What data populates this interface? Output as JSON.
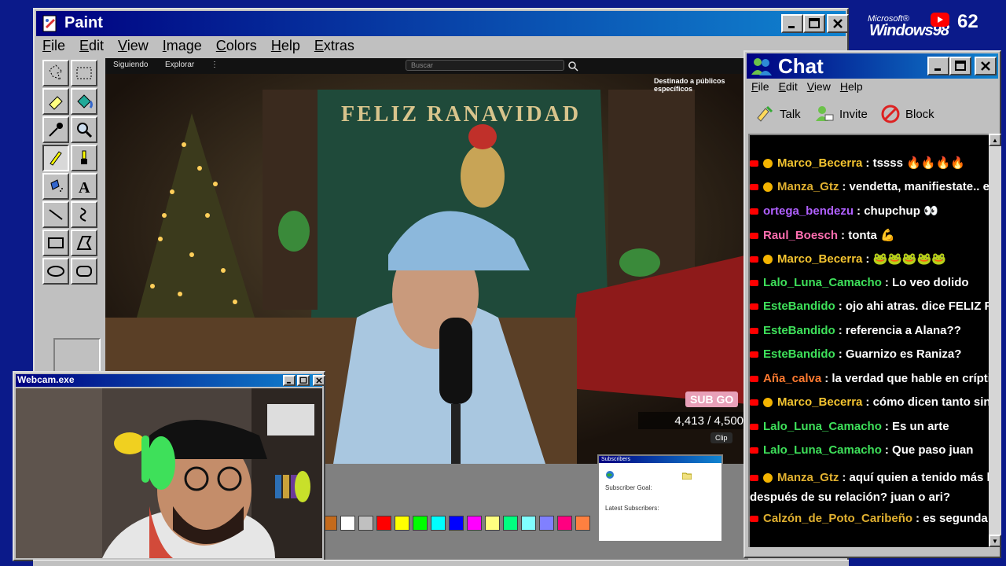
{
  "paint": {
    "title": "Paint",
    "menu": [
      "File",
      "Edit",
      "View",
      "Image",
      "Colors",
      "Help",
      "Extras"
    ]
  },
  "stream": {
    "nav_following": "Siguiendo",
    "nav_explore": "Explorar",
    "nav_more": "⋮",
    "search_placeholder": "Buscar",
    "audience_notice": "Destinado a públicos específicos",
    "sign_text": "FELIZ RANAVIDAD",
    "counter": "4,413  / 4,500",
    "sub_goal_label": "SUB GO",
    "clip_label": "Clip"
  },
  "subscribers_widget": {
    "title": "Subscribers",
    "goal_label": "Subscriber Goal:",
    "latest_label": "Latest Subscribers:"
  },
  "palette_colors": [
    "#c46a1c",
    "#ffffff",
    "#c0c0c0",
    "#ff0000",
    "#ffff00",
    "#00ff00",
    "#00ffff",
    "#0000ff",
    "#ff00ff",
    "#ffff80",
    "#00ff80",
    "#80ffff",
    "#8080ff",
    "#ff0080",
    "#ff8040"
  ],
  "branding": {
    "microsoft": "Microsoft®",
    "windows": "Windows98",
    "youtube_count": "62"
  },
  "chat": {
    "title": "Chat",
    "menu": [
      "File",
      "Edit",
      "View",
      "Help"
    ],
    "toolbar": {
      "talk": "Talk",
      "invite": "Invite",
      "block": "Block"
    },
    "messages": [
      {
        "user": "Marco_Becerra",
        "color": "#f4c430",
        "badge": true,
        "text": ": tssss 🔥🔥🔥🔥"
      },
      {
        "user": "Manza_Gtz",
        "color": "#e0b030",
        "badge": true,
        "text": ": vendetta, manifiestate.. est"
      },
      {
        "user": "ortega_bendezu",
        "color": "#b060ff",
        "badge": false,
        "text": ": chupchup 👀"
      },
      {
        "user": "Raul_Boesch",
        "color": "#ff6fb0",
        "badge": false,
        "text": ": tonta 💪"
      },
      {
        "user": "Marco_Becerra",
        "color": "#f4c430",
        "badge": true,
        "text": ": 🐸🐸🐸🐸🐸"
      },
      {
        "user": "Lalo_Luna_Camacho",
        "color": "#3ee05a",
        "badge": false,
        "text": ": Lo veo dolido"
      },
      {
        "user": "EsteBandido",
        "color": "#3ee05a",
        "badge": false,
        "text": ": ojo ahi atras. dice FELIZ RA"
      },
      {
        "user": "EsteBandido",
        "color": "#3ee05a",
        "badge": false,
        "text": ": referencia a Alana??"
      },
      {
        "user": "EsteBandido",
        "color": "#3ee05a",
        "badge": false,
        "text": ": Guarnizo es Raniza?"
      },
      {
        "user": "Aña_calva",
        "color": "#ff7a30",
        "badge": false,
        "text": ": la verdad que hable en críptico"
      },
      {
        "user": "Marco_Becerra",
        "color": "#f4c430",
        "badge": true,
        "text": ": cómo dicen tanto sin d"
      },
      {
        "user": "Lalo_Luna_Camacho",
        "color": "#3ee05a",
        "badge": false,
        "text": ": Es un arte"
      },
      {
        "user": "Lalo_Luna_Camacho",
        "color": "#3ee05a",
        "badge": false,
        "text": ": Que paso juan"
      },
      {
        "user": "Manza_Gtz",
        "color": "#e0b030",
        "badge": true,
        "text": ": aquí quien a tenido más la c después de su relación? juan o ari?"
      },
      {
        "user": "Calzón_de_Poto_Caribeño",
        "color": "#e0b030",
        "badge": false,
        "text": ": es segunda ve"
      }
    ]
  },
  "webcam": {
    "title": "Webcam.exe"
  }
}
